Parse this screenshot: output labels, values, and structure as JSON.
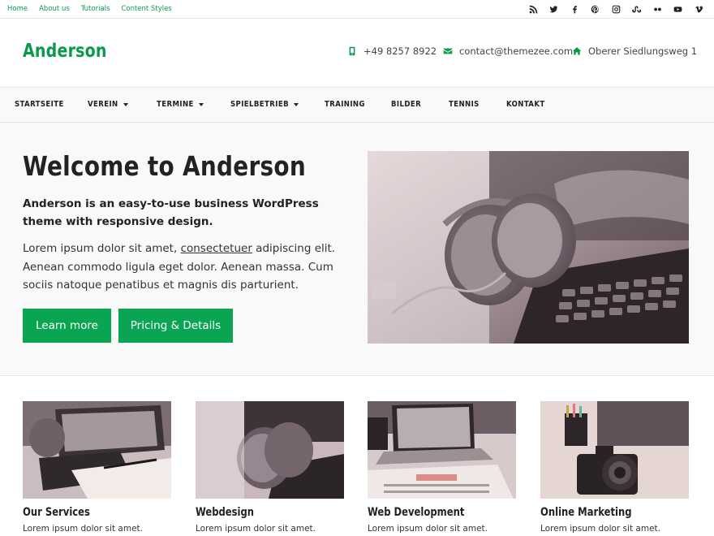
{
  "topbar": {
    "links": [
      "Home",
      "About us",
      "Tutorials",
      "Content Styles"
    ],
    "social_icons": [
      "rss-icon",
      "twitter-icon",
      "facebook-icon",
      "pinterest-icon",
      "instagram-icon",
      "stumbleupon-icon",
      "flickr-icon",
      "youtube-icon",
      "vimeo-icon"
    ]
  },
  "header": {
    "logo": "Anderson",
    "phone": "+49 8257 8922",
    "email": "contact@themezee.com",
    "address": "Oberer Siedlungsweg 1"
  },
  "nav": {
    "items": [
      {
        "label": "STARTSEITE",
        "dropdown": false
      },
      {
        "label": "VEREIN",
        "dropdown": true
      },
      {
        "label": "TERMINE",
        "dropdown": true
      },
      {
        "label": "SPIELBETRIEB",
        "dropdown": true
      },
      {
        "label": "TRAINING",
        "dropdown": false
      },
      {
        "label": "BILDER",
        "dropdown": false
      },
      {
        "label": "TENNIS",
        "dropdown": false
      },
      {
        "label": "KONTAKT",
        "dropdown": false
      }
    ]
  },
  "hero": {
    "title": "Welcome to Anderson",
    "subtitle": "Anderson is an easy-to-use business WordPress theme with responsive design.",
    "text_before_link": "Lorem ipsum dolor sit amet, ",
    "link_text": "consectetuer",
    "text_after_link": " adipiscing elit. Aenean commodo ligula eget dolor. Aenean massa. Cum sociis natoque penatibus et magnis dis parturient.",
    "button_primary": "Learn more",
    "button_secondary": "Pricing & Details"
  },
  "cards": [
    {
      "title": "Our Services",
      "text": "Lorem ipsum dolor sit amet."
    },
    {
      "title": "Webdesign",
      "text": "Lorem ipsum dolor sit amet."
    },
    {
      "title": "Web Development",
      "text": "Lorem ipsum dolor sit amet."
    },
    {
      "title": "Online Marketing",
      "text": "Lorem ipsum dolor sit amet."
    }
  ],
  "colors": {
    "accent": "#0aa553",
    "link": "#0b9a4c",
    "text": "#222222",
    "band_background": "#f9f9f9"
  }
}
